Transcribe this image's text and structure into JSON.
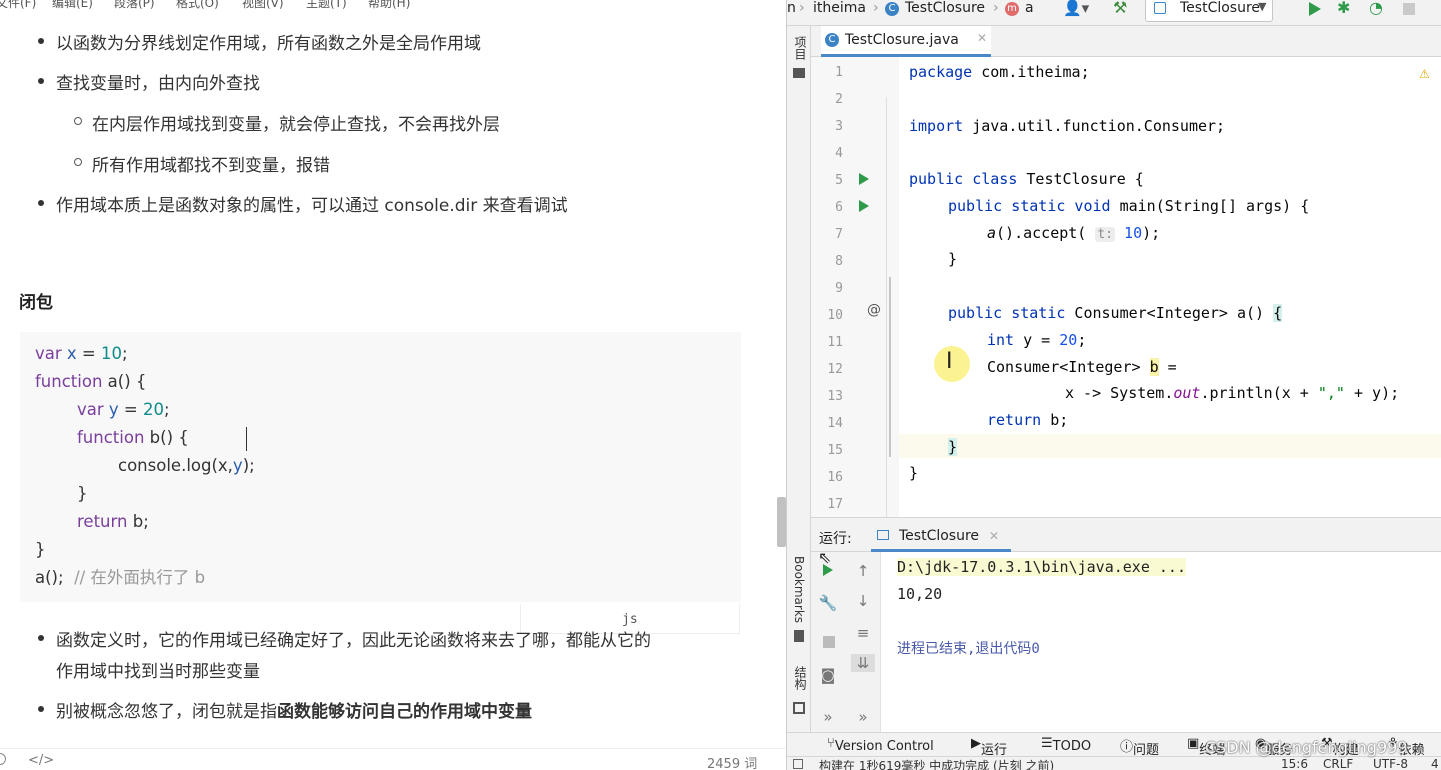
{
  "left": {
    "menu": [
      "文件(F)",
      "编辑(E)",
      "段落(P)",
      "格式(O)",
      "视图(V)",
      "主题(T)",
      "帮助(H)"
    ],
    "bullets1": [
      "以函数为分界线划定作用域，所有函数之外是全局作用域",
      "查找变量时，由内向外查找"
    ],
    "bullets2": [
      "在内层作用域找到变量，就会停止查找，不会再找外层",
      "所有作用域都找不到变量，报错"
    ],
    "bullet3": "作用域本质上是函数对象的属性，可以通过 console.dir 来查看调试",
    "heading": "闭包",
    "code": {
      "l1": {
        "kw": "var",
        "name": "x",
        "op": " = ",
        "num": "10",
        "end": ";"
      },
      "l2": {
        "kw": "function",
        "name": "a",
        "rest": "() {"
      },
      "l3": {
        "kw": "var",
        "name": "y",
        "op": " = ",
        "num": "20",
        "end": ";"
      },
      "l4": {
        "kw": "function",
        "name": "b",
        "rest": "() {"
      },
      "l5": {
        "obj": "console",
        "dot": ".",
        "fn": "log",
        "open": "(",
        "a1": "x",
        "comma": ",",
        "a2": "y",
        "close": ");"
      },
      "l6": "}",
      "l7": {
        "kw": "return",
        "name": "b",
        "end": ";"
      },
      "l8": "}",
      "l9": {
        "call": "a",
        "rest": "();",
        "comment": "// 在外面执行了 b"
      }
    },
    "lang": "js",
    "bullet4a": "函数定义时，它的作用域已经确定好了，因此无论函数将来去了哪，都能从它的",
    "bullet4b": "作用域中找到当时那些变量",
    "bullet5a": "别被概念忽悠了，闭包就是指",
    "bullet5b": "函数能够访问自己的作用域中变量",
    "status": {
      "src_icon": "</>",
      "words": "2459 词"
    }
  },
  "ide": {
    "breadcrumbs": [
      "n",
      "itheima",
      "TestClosure",
      "a"
    ],
    "run_config": "TestClosure",
    "side_tabs": [
      "项目",
      "Bookmarks",
      "结构"
    ],
    "file_tab": "TestClosure.java",
    "line_numbers": [
      "1",
      "2",
      "3",
      "4",
      "5",
      "6",
      "7",
      "8",
      "9",
      "10",
      "11",
      "12",
      "13",
      "14",
      "15",
      "16",
      "17"
    ],
    "code": {
      "l1": {
        "kw": "package",
        "rest": " com.itheima;"
      },
      "l3": {
        "kw": "import",
        "rest": " java.util.function.Consumer;"
      },
      "l5": {
        "kw": "public class",
        "rest": " TestClosure {"
      },
      "l6": {
        "kw": "public static void",
        "name": " main",
        "rest": "(String[] args) {"
      },
      "l7": {
        "call": "a",
        "mid": "().accept( ",
        "hint": "t:",
        "num": " 10",
        "end": ");"
      },
      "l8": "}",
      "l10": {
        "kw": "public static",
        "type": " Consumer<Integer> ",
        "name": "a",
        "rest": "() ",
        "brace": "{"
      },
      "l11": {
        "kw": "int",
        "rest": " y = ",
        "num": "20",
        "end": ";"
      },
      "l12": {
        "rest": "Consumer<Integer> ",
        "var": "b",
        "end": " ="
      },
      "l13": {
        "a": "x -> System.",
        "field": "out",
        "b": ".println(x + ",
        "str": "\",\"",
        "c": " + y);"
      },
      "l14": {
        "kw": "return",
        "rest": " b;"
      },
      "l15": "}",
      "l16": "}"
    },
    "run": {
      "label": "运行:",
      "tab": "TestClosure",
      "cmd": "D:\\jdk-17.0.3.1\\bin\\java.exe ...",
      "output": "10,20",
      "exit": "进程已结束,退出代码0"
    },
    "bottom_tabs": [
      "Version Control",
      "运行",
      "TODO",
      "问题",
      "终端",
      "服务",
      "构建",
      "依赖"
    ],
    "status": {
      "left": "构建在 1秒619毫秒 中成功完成 (片刻 之前)",
      "pos": "15:6",
      "crlf": "CRLF",
      "enc": "UTF-8",
      "indent": "4"
    }
  },
  "watermark": "CSDN @dengfengling999"
}
